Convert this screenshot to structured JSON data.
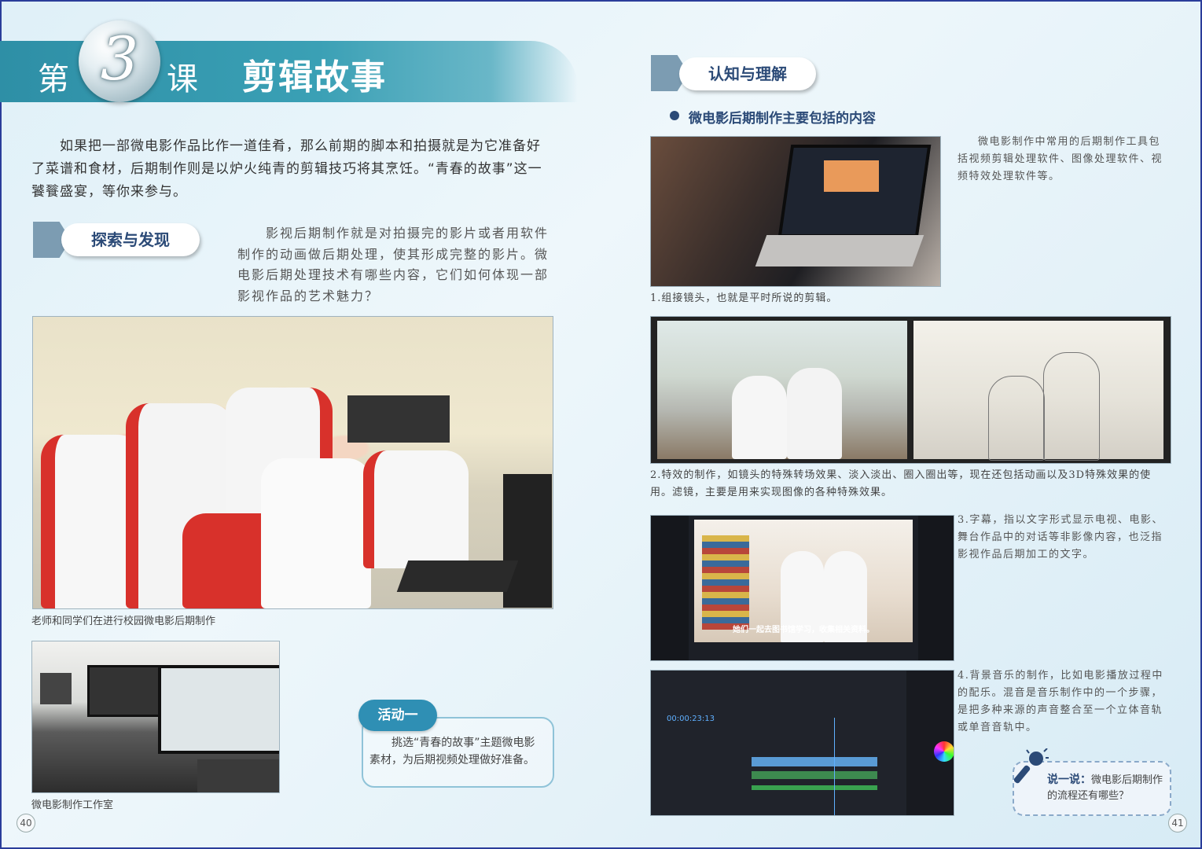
{
  "left_page": {
    "lesson": {
      "prefix": "第",
      "number": "3",
      "suffix": "课",
      "title": "剪辑故事"
    },
    "intro": "如果把一部微电影作品比作一道佳肴，那么前期的脚本和拍摄就是为它准备好了菜谱和食材，后期制作则是以炉火纯青的剪辑技巧将其烹饪。“青春的故事”这一饕餮盛宴，等你来参与。",
    "explore_tag": "探索与发现",
    "explore_text": "影视后期制作就是对拍摄完的影片或者用软件制作的动画做后期处理，使其形成完整的影片。微电影后期处理技术有哪些内容，它们如何体现一部影视作品的艺术魅力？",
    "photo1_caption": "老师和同学们在进行校园微电影后期制作",
    "photo2_caption": "微电影制作工作室",
    "activity_label": "活动一",
    "activity_text": "挑选“青春的故事”主题微电影素材，为后期视频处理做好准备。",
    "page_number": "40"
  },
  "right_page": {
    "section_tag": "认知与理解",
    "bullet_heading": "微电影后期制作主要包括的内容",
    "tools_text": "微电影制作中常用的后期制作工具包括视频剪辑处理软件、图像处理软件、视频特效处理软件等。",
    "item1": "1.组接镜头，也就是平时所说的剪辑。",
    "item2": "2.特效的制作，如镜头的特殊转场效果、淡入淡出、圈入圈出等，现在还包括动画以及3D特殊效果的使用。滤镜，主要是用来实现图像的各种特殊效果。",
    "item3": "3.字幕，指以文字形式显示电视、电影、舞台作品中的对话等非影像内容，也泛指影视作品后期加工的文字。",
    "item4": "4.背景音乐的制作，比如电影播放过程中的配乐。混音是音乐制作中的一个步骤，是把多种来源的声音整合至一个立体音轨或单音音轨中。",
    "subtitle_in_screenshot": "她们一起去图书馆学习，收集相关资料。",
    "timecode": "00:00:23:13",
    "say_label": "说一说：",
    "say_text": "微电影后期制作的流程还有哪些？",
    "page_number": "41"
  },
  "icons": [
    "microphone-icon",
    "arrow-tag-icon",
    "bullet-dot-icon",
    "cloud-icon"
  ]
}
